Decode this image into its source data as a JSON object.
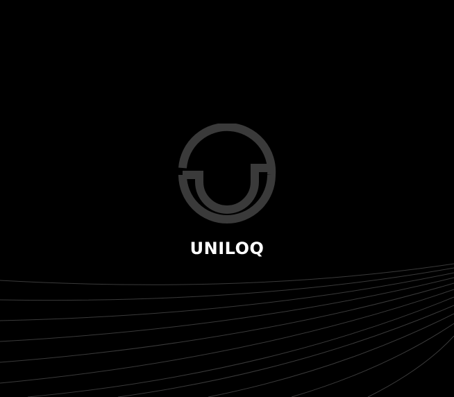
{
  "splash": {
    "brand_name": "UNILOQ",
    "logo_icon": "uniloq-logo-icon",
    "background_color": "#000000",
    "logo_color": "#3a3a3a",
    "text_color": "#ffffff",
    "line_color": "#3a3a3a"
  }
}
